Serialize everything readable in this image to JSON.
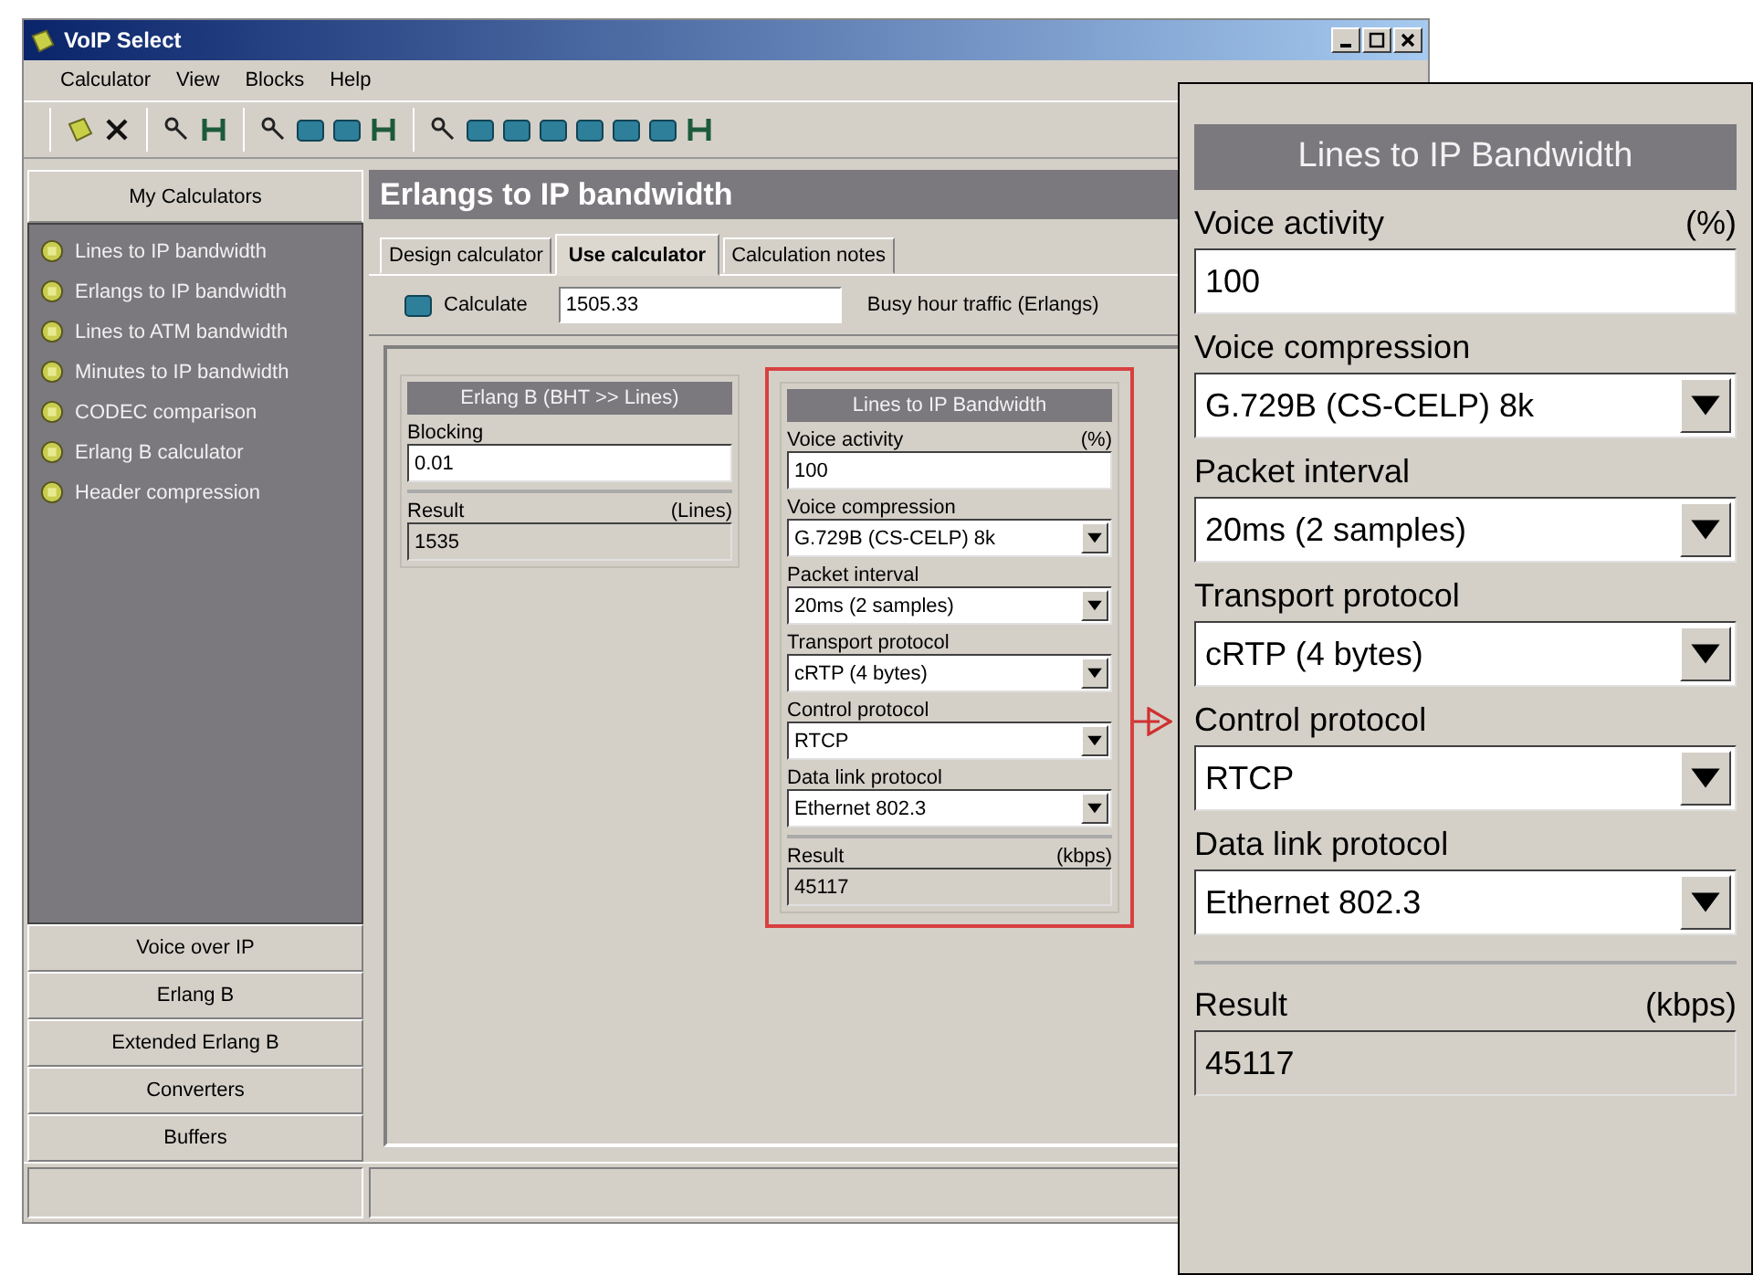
{
  "window": {
    "title": "VoIP Select"
  },
  "menu": [
    "Calculator",
    "View",
    "Blocks",
    "Help"
  ],
  "sidebar": {
    "header": "My Calculators",
    "items": [
      "Lines to IP bandwidth",
      "Erlangs to IP bandwidth",
      "Lines to ATM bandwidth",
      "Minutes to IP bandwidth",
      "CODEC comparison",
      "Erlang B calculator",
      "Header compression"
    ],
    "sections": [
      "Voice over IP",
      "Erlang B",
      "Extended Erlang B",
      "Converters",
      "Buffers"
    ]
  },
  "content": {
    "title": "Erlangs to IP bandwidth",
    "tabs": [
      {
        "label": "Design calculator",
        "selected": false
      },
      {
        "label": "Use calculator",
        "selected": true
      },
      {
        "label": "Calculation notes",
        "selected": false
      }
    ],
    "calculate_button": "Calculate",
    "traffic_value": "1505.33",
    "traffic_label": "Busy hour traffic (Erlangs)",
    "erlang_panel": {
      "title": "Erlang B (BHT >> Lines)",
      "fields": [
        {
          "kind": "input",
          "label": "Blocking",
          "value": "0.01"
        },
        {
          "kind": "result",
          "label": "Result",
          "unit": "(Lines)",
          "value": "1535"
        }
      ]
    },
    "lines_panel": {
      "title": "Lines to IP Bandwidth",
      "fields": [
        {
          "kind": "input",
          "label": "Voice activity",
          "unit": "(%)",
          "value": "100"
        },
        {
          "kind": "select",
          "label": "Voice compression",
          "value": "G.729B (CS-CELP) 8k"
        },
        {
          "kind": "select",
          "label": "Packet interval",
          "value": "20ms (2 samples)"
        },
        {
          "kind": "select",
          "label": "Transport protocol",
          "value": "cRTP (4 bytes)"
        },
        {
          "kind": "select",
          "label": "Control protocol",
          "value": "RTCP"
        },
        {
          "kind": "select",
          "label": "Data link protocol",
          "value": "Ethernet 802.3"
        },
        {
          "kind": "result",
          "label": "Result",
          "unit": "(kbps)",
          "value": "45117"
        }
      ]
    }
  },
  "zoomed_panel": {
    "title": "Lines to IP Bandwidth",
    "fields": [
      {
        "kind": "input",
        "label": "Voice activity",
        "unit": "(%)",
        "value": "100"
      },
      {
        "kind": "select",
        "label": "Voice compression",
        "value": "G.729B (CS-CELP) 8k"
      },
      {
        "kind": "select",
        "label": "Packet interval",
        "value": "20ms (2 samples)"
      },
      {
        "kind": "select",
        "label": "Transport protocol",
        "value": "cRTP (4 bytes)"
      },
      {
        "kind": "select",
        "label": "Control protocol",
        "value": "RTCP"
      },
      {
        "kind": "select",
        "label": "Data link protocol",
        "value": "Ethernet 802.3"
      },
      {
        "kind": "result",
        "label": "Result",
        "unit": "(kbps)",
        "value": "45117"
      }
    ]
  }
}
